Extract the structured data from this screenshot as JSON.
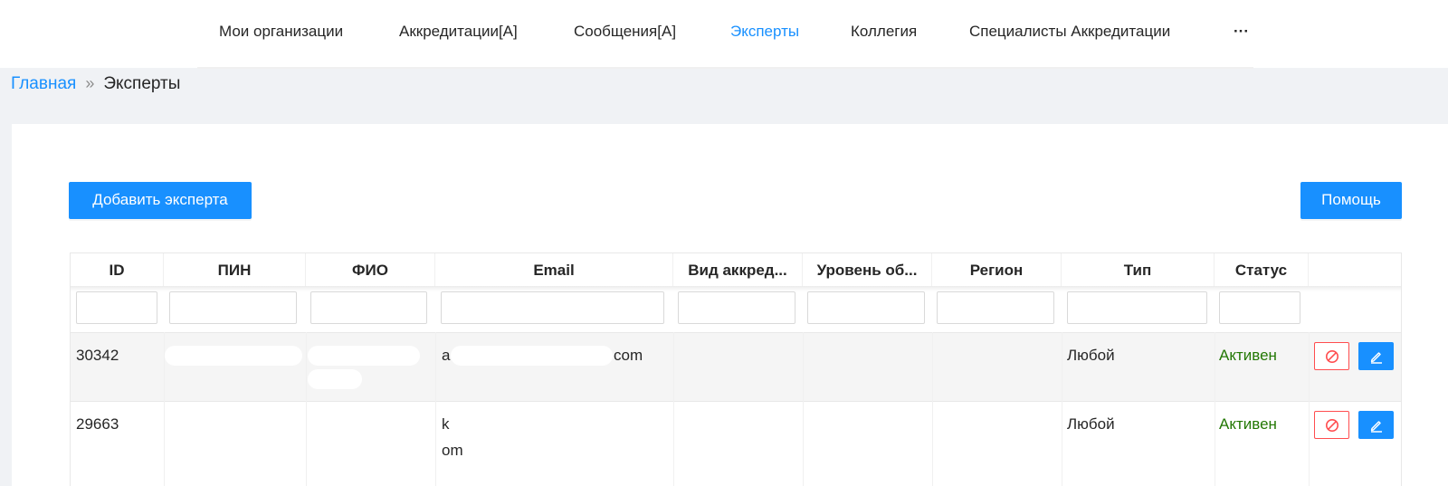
{
  "nav": {
    "items": [
      {
        "label": "Мои организации"
      },
      {
        "label": "Аккредитации[A]"
      },
      {
        "label": "Сообщения[A]"
      },
      {
        "label": "Эксперты"
      },
      {
        "label": "Коллегия"
      },
      {
        "label": "Специалисты Аккредитации"
      }
    ],
    "more": "···"
  },
  "breadcrumb": {
    "home": "Главная",
    "separator": "»",
    "current": "Эксперты"
  },
  "toolbar": {
    "add_label": "Добавить эксперта",
    "help_label": "Помощь"
  },
  "table": {
    "columns": [
      "ID",
      "ПИН",
      "ФИО",
      "Email",
      "Вид аккред...",
      "Уровень об...",
      "Регион",
      "Тип",
      "Статус",
      ""
    ],
    "rows": [
      {
        "id": "30342",
        "pin": "",
        "fio": "",
        "email_start": "a",
        "email_end": "com",
        "vid": "",
        "level": "",
        "region": "",
        "type": "Любой",
        "status": "Активен"
      },
      {
        "id": "29663",
        "pin": "",
        "fio": "",
        "email_start": "k",
        "email_end": "om",
        "vid": "",
        "level": "",
        "region": "",
        "type": "Любой",
        "status": "Активен"
      }
    ]
  },
  "icons": {
    "block": "block-icon",
    "edit": "edit-icon"
  },
  "colors": {
    "accent": "#1890ff",
    "status_active": "#237804",
    "danger": "#ff4d4f"
  }
}
